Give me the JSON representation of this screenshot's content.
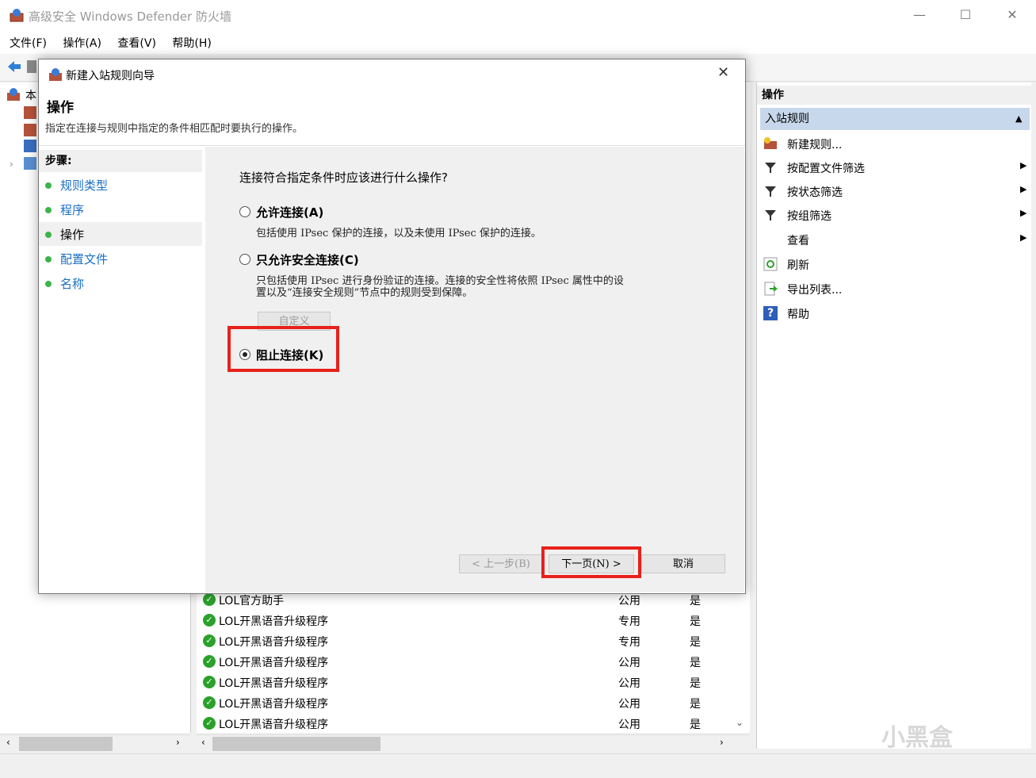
{
  "window": {
    "title": "高级安全 Windows Defender 防火墙"
  },
  "menu": [
    "文件(F)",
    "操作(A)",
    "查看(V)",
    "帮助(H)"
  ],
  "tree": {
    "root_label_partial": "本"
  },
  "rules": [
    {
      "name": "LOL官方助手",
      "profile": "公用",
      "enabled": "是"
    },
    {
      "name": "LOL开黑语音升级程序",
      "profile": "专用",
      "enabled": "是"
    },
    {
      "name": "LOL开黑语音升级程序",
      "profile": "专用",
      "enabled": "是"
    },
    {
      "name": "LOL开黑语音升级程序",
      "profile": "公用",
      "enabled": "是"
    },
    {
      "name": "LOL开黑语音升级程序",
      "profile": "公用",
      "enabled": "是"
    },
    {
      "name": "LOL开黑语音升级程序",
      "profile": "公用",
      "enabled": "是"
    },
    {
      "name": "LOL开黑语音升级程序",
      "profile": "公用",
      "enabled": "是"
    }
  ],
  "actions": {
    "header": "操作",
    "section": "入站规则",
    "items": [
      {
        "label": "新建规则...",
        "icon": "new-rule-icon",
        "submenu": false
      },
      {
        "label": "按配置文件筛选",
        "icon": "filter-icon",
        "submenu": true
      },
      {
        "label": "按状态筛选",
        "icon": "filter-icon",
        "submenu": true
      },
      {
        "label": "按组筛选",
        "icon": "filter-icon",
        "submenu": true
      },
      {
        "label": "查看",
        "icon": "",
        "submenu": true
      },
      {
        "label": "刷新",
        "icon": "refresh-icon",
        "submenu": false
      },
      {
        "label": "导出列表...",
        "icon": "export-icon",
        "submenu": false
      },
      {
        "label": "帮助",
        "icon": "help-icon",
        "submenu": false
      }
    ]
  },
  "dialog": {
    "title": "新建入站规则向导",
    "heading": "操作",
    "description": "指定在连接与规则中指定的条件相匹配时要执行的操作。",
    "steps_title": "步骤:",
    "steps": [
      "规则类型",
      "程序",
      "操作",
      "配置文件",
      "名称"
    ],
    "current_step": 2,
    "question": "连接符合指定条件时应该进行什么操作?",
    "options": [
      {
        "label": "允许连接(A)",
        "desc": "包括使用 IPsec 保护的连接，以及未使用 IPsec 保护的连接。",
        "selected": false
      },
      {
        "label": "只允许安全连接(C)",
        "desc_line1": "只包括使用 IPsec 进行身份验证的连接。连接的安全性将依照 IPsec 属性中的设",
        "desc_line2": "置以及“连接安全规则”节点中的规则受到保障。",
        "selected": false
      },
      {
        "label": "阻止连接(K)",
        "selected": true
      }
    ],
    "customize_label": "自定义",
    "buttons": {
      "back": "< 上一步(B)",
      "next": "下一页(N) >",
      "cancel": "取消"
    }
  },
  "watermark": "小黑盒",
  "colors": {
    "highlight": "#e8211b",
    "link": "#1a6fc4",
    "ok_green": "#2aa12a",
    "selected_section": "#c8d8ec"
  }
}
